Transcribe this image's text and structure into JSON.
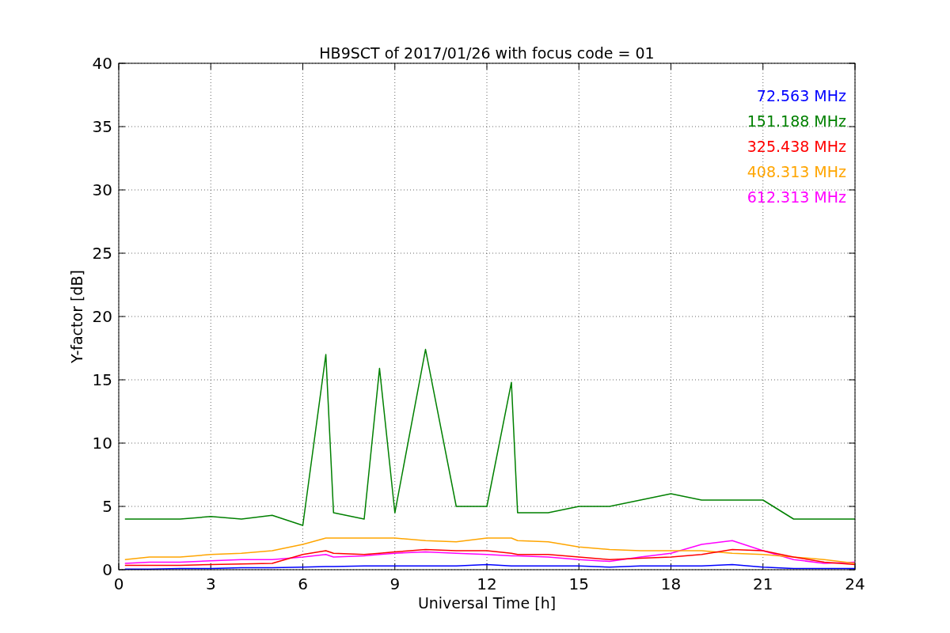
{
  "chart_data": {
    "type": "line",
    "title": "HB9SCT of 2017/01/26 with focus code = 01",
    "xlabel": "Universal Time [h]",
    "ylabel": "Y-factor [dB]",
    "x": [
      0.2,
      1,
      2,
      3,
      4,
      5,
      6,
      6.75,
      7,
      8,
      8.5,
      9,
      10,
      11,
      12,
      12.8,
      13,
      14,
      15,
      16,
      17,
      18,
      19,
      20,
      21,
      22,
      23,
      24
    ],
    "grid": true,
    "xlim": [
      0,
      24
    ],
    "ylim": [
      0,
      40
    ],
    "xticks": [
      0,
      3,
      6,
      9,
      12,
      15,
      18,
      21,
      24
    ],
    "yticks": [
      0,
      5,
      10,
      15,
      20,
      25,
      30,
      35,
      40
    ],
    "series": [
      {
        "name": "72.563 MHz",
        "color": "#0000ff",
        "values": [
          0.05,
          0.05,
          0.1,
          0.1,
          0.15,
          0.15,
          0.2,
          0.25,
          0.25,
          0.3,
          0.3,
          0.3,
          0.3,
          0.3,
          0.4,
          0.3,
          0.3,
          0.3,
          0.3,
          0.2,
          0.3,
          0.3,
          0.3,
          0.4,
          0.2,
          0.1,
          0.1,
          0.1
        ]
      },
      {
        "name": "151.188 MHz",
        "color": "#008000",
        "values": [
          4,
          4,
          4,
          4.2,
          4,
          4.3,
          3.5,
          17,
          4.5,
          4,
          15.9,
          4.5,
          17.4,
          5,
          5,
          14.8,
          4.5,
          4.5,
          5,
          5,
          5.5,
          6,
          5.5,
          5.5,
          5.5,
          4,
          4,
          4
        ]
      },
      {
        "name": "325.438 MHz",
        "color": "#ff0000",
        "values": [
          0.35,
          0.35,
          0.35,
          0.4,
          0.45,
          0.5,
          1.2,
          1.5,
          1.3,
          1.2,
          1.3,
          1.4,
          1.6,
          1.5,
          1.5,
          1.3,
          1.2,
          1.2,
          1,
          0.8,
          0.9,
          1,
          1.2,
          1.6,
          1.5,
          1,
          0.6,
          0.4
        ]
      },
      {
        "name": "408.313 MHz",
        "color": "#ffa500",
        "values": [
          0.8,
          1,
          1,
          1.2,
          1.3,
          1.5,
          2,
          2.5,
          2.5,
          2.5,
          2.5,
          2.5,
          2.3,
          2.2,
          2.5,
          2.5,
          2.3,
          2.2,
          1.8,
          1.6,
          1.5,
          1.5,
          1.5,
          1.3,
          1.2,
          1,
          0.8,
          0.5
        ]
      },
      {
        "name": "612.313 MHz",
        "color": "#ff00ff",
        "values": [
          0.5,
          0.6,
          0.6,
          0.7,
          0.8,
          0.8,
          1,
          1.2,
          1,
          1.1,
          1.2,
          1.3,
          1.4,
          1.3,
          1.2,
          1.1,
          1.1,
          1,
          0.8,
          0.65,
          1,
          1.3,
          2,
          2.3,
          1.5,
          0.8,
          0.5,
          0.6
        ]
      }
    ]
  }
}
